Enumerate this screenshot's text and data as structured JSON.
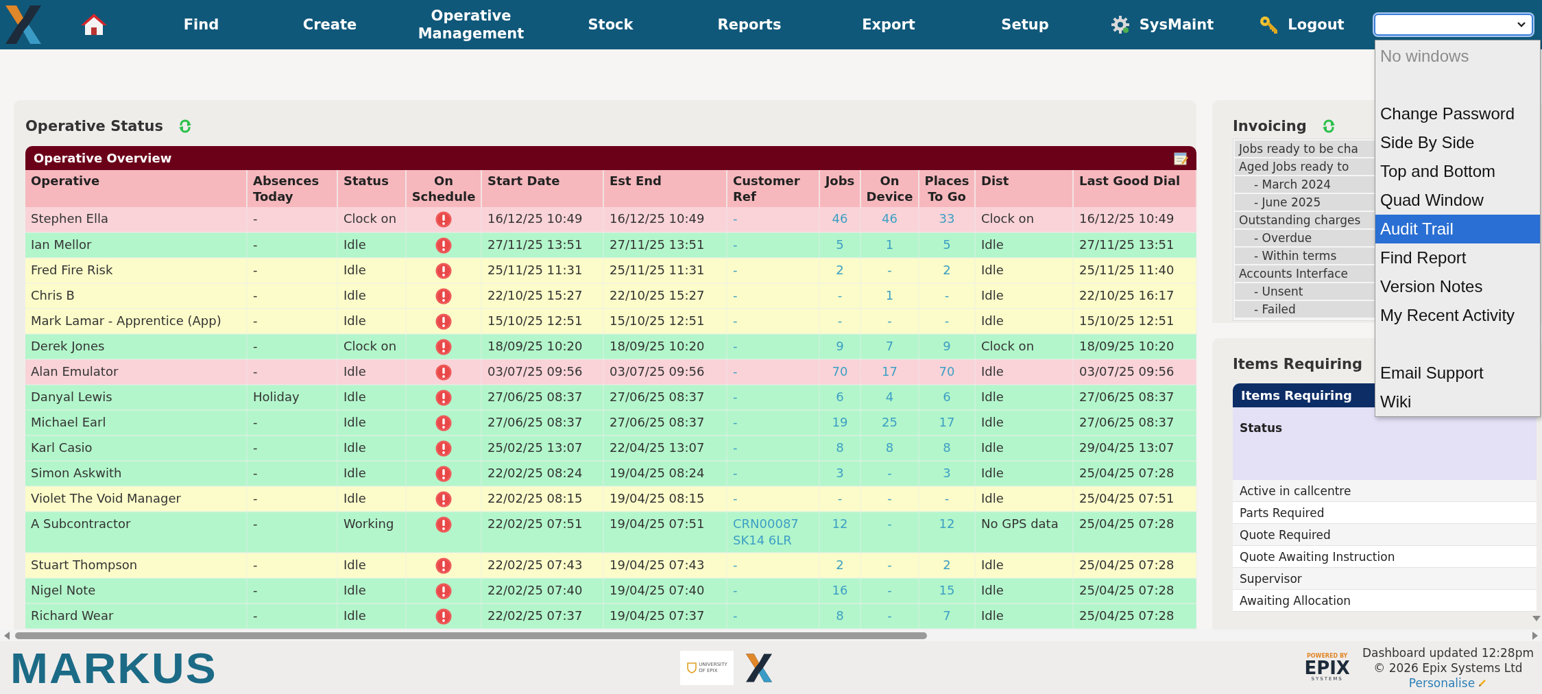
{
  "nav": {
    "items": [
      {
        "kind": "logo"
      },
      {
        "kind": "home"
      },
      {
        "kind": "link",
        "label": "Find"
      },
      {
        "kind": "link",
        "label": "Create"
      },
      {
        "kind": "link",
        "label": "Operative Management"
      },
      {
        "kind": "link",
        "label": "Stock"
      },
      {
        "kind": "link",
        "label": "Reports"
      },
      {
        "kind": "link",
        "label": "Export"
      },
      {
        "kind": "link",
        "label": "Setup"
      },
      {
        "kind": "settings",
        "label": "SysMaint"
      },
      {
        "kind": "logout",
        "label": "Logout"
      }
    ]
  },
  "window_select": {
    "expanded": true,
    "options": [
      {
        "kind": "option",
        "label": "No windows",
        "disabled": true,
        "selected": false
      },
      {
        "kind": "gap"
      },
      {
        "kind": "option",
        "label": "Change Password",
        "disabled": false,
        "selected": false
      },
      {
        "kind": "option",
        "label": "Side By Side",
        "disabled": false,
        "selected": false
      },
      {
        "kind": "option",
        "label": "Top and Bottom",
        "disabled": false,
        "selected": false
      },
      {
        "kind": "option",
        "label": "Quad Window",
        "disabled": false,
        "selected": false
      },
      {
        "kind": "option",
        "label": "Audit Trail",
        "disabled": false,
        "selected": true
      },
      {
        "kind": "option",
        "label": "Find Report",
        "disabled": false,
        "selected": false
      },
      {
        "kind": "option",
        "label": "Version Notes",
        "disabled": false,
        "selected": false
      },
      {
        "kind": "option",
        "label": "My Recent Activity",
        "disabled": false,
        "selected": false
      },
      {
        "kind": "gap"
      },
      {
        "kind": "option",
        "label": "Email Support",
        "disabled": false,
        "selected": false
      },
      {
        "kind": "option",
        "label": "Wiki",
        "disabled": false,
        "selected": false
      }
    ]
  },
  "operative_status": {
    "title": "Operative Status",
    "table": {
      "title": "Operative Overview",
      "columns": [
        {
          "label": "Operative",
          "kind": "text"
        },
        {
          "label": "Absences Today",
          "kind": "text"
        },
        {
          "label": "Status",
          "kind": "text"
        },
        {
          "label": "On Schedule",
          "kind": "flag"
        },
        {
          "label": "Start Date",
          "kind": "text"
        },
        {
          "label": "Est End",
          "kind": "text"
        },
        {
          "label": "Customer Ref",
          "kind": "link"
        },
        {
          "label": "Jobs",
          "kind": "number"
        },
        {
          "label": "On Device",
          "kind": "number"
        },
        {
          "label": "Places To Go",
          "kind": "number"
        },
        {
          "label": "Dist",
          "kind": "text"
        },
        {
          "label": "Last Good Dial",
          "kind": "text"
        }
      ],
      "rows": [
        {
          "color": "#f9d3d8",
          "cells": [
            "Stephen Ella",
            "-",
            "Clock on",
            {
              "on_schedule": false
            },
            "16/12/25 10:49",
            "16/12/25 10:49",
            "-",
            "46",
            "46",
            "33",
            "Clock on",
            "16/12/25 10:49"
          ]
        },
        {
          "color": "#b3f6cb",
          "cells": [
            "Ian Mellor",
            "-",
            "Idle",
            {
              "on_schedule": false
            },
            "27/11/25 13:51",
            "27/11/25 13:51",
            "-",
            "5",
            "1",
            "5",
            "Idle",
            "27/11/25 13:51"
          ]
        },
        {
          "color": "#fbfcc9",
          "cells": [
            "Fred Fire Risk",
            "-",
            "Idle",
            {
              "on_schedule": false
            },
            "25/11/25 11:31",
            "25/11/25 11:31",
            "-",
            "2",
            "-",
            "2",
            "Idle",
            "25/11/25 11:40"
          ]
        },
        {
          "color": "#fbfcc9",
          "cells": [
            "Chris B",
            "-",
            "Idle",
            {
              "on_schedule": false
            },
            "22/10/25 15:27",
            "22/10/25 15:27",
            "-",
            "-",
            "1",
            "-",
            "Idle",
            "22/10/25 16:17"
          ]
        },
        {
          "color": "#fbfcc9",
          "cells": [
            "Mark Lamar - Apprentice (App)",
            "-",
            "Idle",
            {
              "on_schedule": false
            },
            "15/10/25 12:51",
            "15/10/25 12:51",
            "-",
            "-",
            "-",
            "-",
            "Idle",
            "15/10/25 12:51"
          ]
        },
        {
          "color": "#b3f6cb",
          "cells": [
            "Derek Jones",
            "-",
            "Clock on",
            {
              "on_schedule": false
            },
            "18/09/25 10:20",
            "18/09/25 10:20",
            "-",
            "9",
            "7",
            "9",
            "Clock on",
            "18/09/25 10:20"
          ]
        },
        {
          "color": "#f9d3d8",
          "cells": [
            "Alan Emulator",
            "-",
            "Idle",
            {
              "on_schedule": false
            },
            "03/07/25 09:56",
            "03/07/25 09:56",
            "-",
            "70",
            "17",
            "70",
            "Idle",
            "03/07/25 09:56"
          ]
        },
        {
          "color": "#b3f6cb",
          "cells": [
            "Danyal Lewis",
            "Holiday",
            "Idle",
            {
              "on_schedule": false
            },
            "27/06/25 08:37",
            "27/06/25 08:37",
            "-",
            "6",
            "4",
            "6",
            "Idle",
            "27/06/25 08:37"
          ]
        },
        {
          "color": "#b3f6cb",
          "cells": [
            "Michael Earl",
            "-",
            "Idle",
            {
              "on_schedule": false
            },
            "27/06/25 08:37",
            "27/06/25 08:37",
            "-",
            "19",
            "25",
            "17",
            "Idle",
            "27/06/25 08:37"
          ]
        },
        {
          "color": "#b3f6cb",
          "cells": [
            "Karl Casio",
            "-",
            "Idle",
            {
              "on_schedule": false
            },
            "25/02/25 13:07",
            "22/04/25 13:07",
            "-",
            "8",
            "8",
            "8",
            "Idle",
            "29/04/25 13:07"
          ]
        },
        {
          "color": "#b3f6cb",
          "cells": [
            "Simon Askwith",
            "-",
            "Idle",
            {
              "on_schedule": false
            },
            "22/02/25 08:24",
            "19/04/25 08:24",
            "-",
            "3",
            "-",
            "3",
            "Idle",
            "25/04/25 07:28"
          ]
        },
        {
          "color": "#fbfcc9",
          "cells": [
            "Violet The Void Manager",
            "-",
            "Idle",
            {
              "on_schedule": false
            },
            "22/02/25 08:15",
            "19/04/25 08:15",
            "-",
            "-",
            "-",
            "-",
            "Idle",
            "25/04/25 07:51"
          ]
        },
        {
          "color": "#b3f6cb",
          "cells": [
            "A Subcontractor",
            "-",
            "Working",
            {
              "on_schedule": false
            },
            "22/02/25 07:51",
            "19/04/25 07:51",
            "CRN00087 SK14 6LR",
            "12",
            "-",
            "12",
            "No GPS data",
            "25/04/25 07:28"
          ]
        },
        {
          "color": "#fbfcc9",
          "cells": [
            "Stuart Thompson",
            "-",
            "Idle",
            {
              "on_schedule": false
            },
            "22/02/25 07:43",
            "19/04/25 07:43",
            "-",
            "2",
            "-",
            "2",
            "Idle",
            "25/04/25 07:28"
          ]
        },
        {
          "color": "#b3f6cb",
          "cells": [
            "Nigel Note",
            "-",
            "Idle",
            {
              "on_schedule": false
            },
            "22/02/25 07:40",
            "19/04/25 07:40",
            "-",
            "16",
            "-",
            "15",
            "Idle",
            "25/04/25 07:28"
          ]
        },
        {
          "color": "#b3f6cb",
          "cells": [
            "Richard Wear",
            "-",
            "Idle",
            {
              "on_schedule": false
            },
            "22/02/25 07:37",
            "19/04/25 07:37",
            "-",
            "8",
            "-",
            "7",
            "Idle",
            "25/04/25 07:28"
          ]
        }
      ]
    }
  },
  "invoicing": {
    "title": "Invoicing",
    "items": [
      {
        "label": "Jobs ready to be cha"
      },
      {
        "label": "Aged Jobs ready to",
        "children": [
          {
            "label": "- March 2024"
          },
          {
            "label": "- June 2025"
          }
        ]
      },
      {
        "label": "Outstanding charges",
        "children": [
          {
            "label": "- Overdue"
          },
          {
            "label": "- Within terms"
          }
        ]
      },
      {
        "label": "Accounts Interface",
        "children": [
          {
            "label": "- Unsent"
          },
          {
            "label": "- Failed"
          }
        ]
      }
    ]
  },
  "items_requiring": {
    "title": "Items Requiring",
    "table_title": "Items Requiring",
    "columns": [
      "Status"
    ],
    "rows": [
      "Active in callcentre",
      "Parts Required",
      "Quote Required",
      "Quote Awaiting Instruction",
      "Supervisor",
      "Awaiting Allocation"
    ]
  },
  "footer": {
    "logo": "MARKUS",
    "badge": "UNIVERSITY OF EPIX",
    "powered_by": "POWERED BY",
    "powered_name": "EPIX",
    "powered_sub": "SYSTEMS",
    "updated": "Dashboard updated 12:28pm",
    "copyright": "© 2026 Epix Systems Ltd",
    "personalise": "Personalise"
  }
}
